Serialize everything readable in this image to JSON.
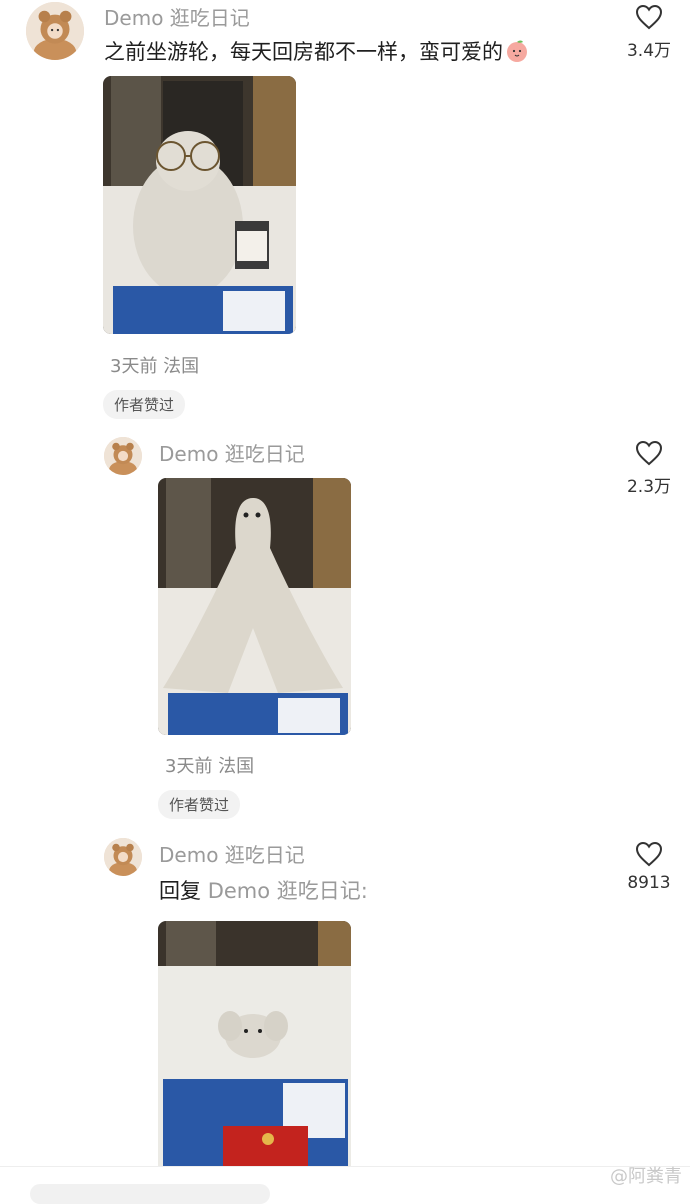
{
  "comments": [
    {
      "username": "Demo 逛吃日记",
      "text": "之前坐游轮，每天回房都不一样，蛮可爱的",
      "emoji": "peach-face-emoji",
      "likes": "3.4万",
      "time_location": "3天前 法国",
      "badge": "作者赞过"
    },
    {
      "username": "Demo 逛吃日记",
      "likes": "2.3万",
      "time_location": "3天前 法国",
      "badge": "作者赞过"
    },
    {
      "username": "Demo 逛吃日记",
      "reply_label": "回复 ",
      "reply_target": "Demo 逛吃日记:",
      "likes": "8913"
    }
  ],
  "watermark": "@阿粪青",
  "icons": {
    "like": "heart-outline-icon"
  },
  "colors": {
    "username": "#9a9a9a",
    "badge_bg": "#f2f2f2",
    "text": "#1f1f1f"
  }
}
